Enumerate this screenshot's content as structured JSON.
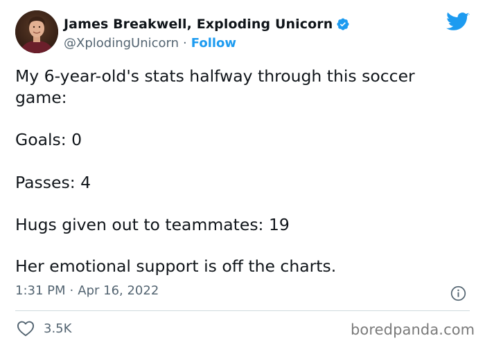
{
  "author": {
    "name": "James Breakwell, Exploding Unicorn",
    "handle": "@XplodingUnicorn",
    "separator": "·",
    "follow_label": "Follow",
    "avatar_icon": "profile-photo",
    "verified_icon": "verified-badge-icon"
  },
  "brand": {
    "icon": "twitter-bird-icon",
    "color": "#1d9bf0"
  },
  "tweet": {
    "lines": [
      "My 6-year-old's stats halfway through this soccer",
      "game:",
      "Goals: 0",
      "Passes: 4",
      "Hugs given out to teammates: 19",
      "Her emotional support is off the charts."
    ],
    "time": "1:31 PM",
    "separator": "·",
    "date": "Apr 16, 2022"
  },
  "actions": {
    "like_icon": "heart-icon",
    "like_count": "3.5K",
    "info_icon": "info-icon"
  },
  "watermark": "boredpanda.com",
  "colors": {
    "text": "#0f1419",
    "secondary": "#536471",
    "accent": "#1d9bf0",
    "divider": "#cfd9de"
  }
}
